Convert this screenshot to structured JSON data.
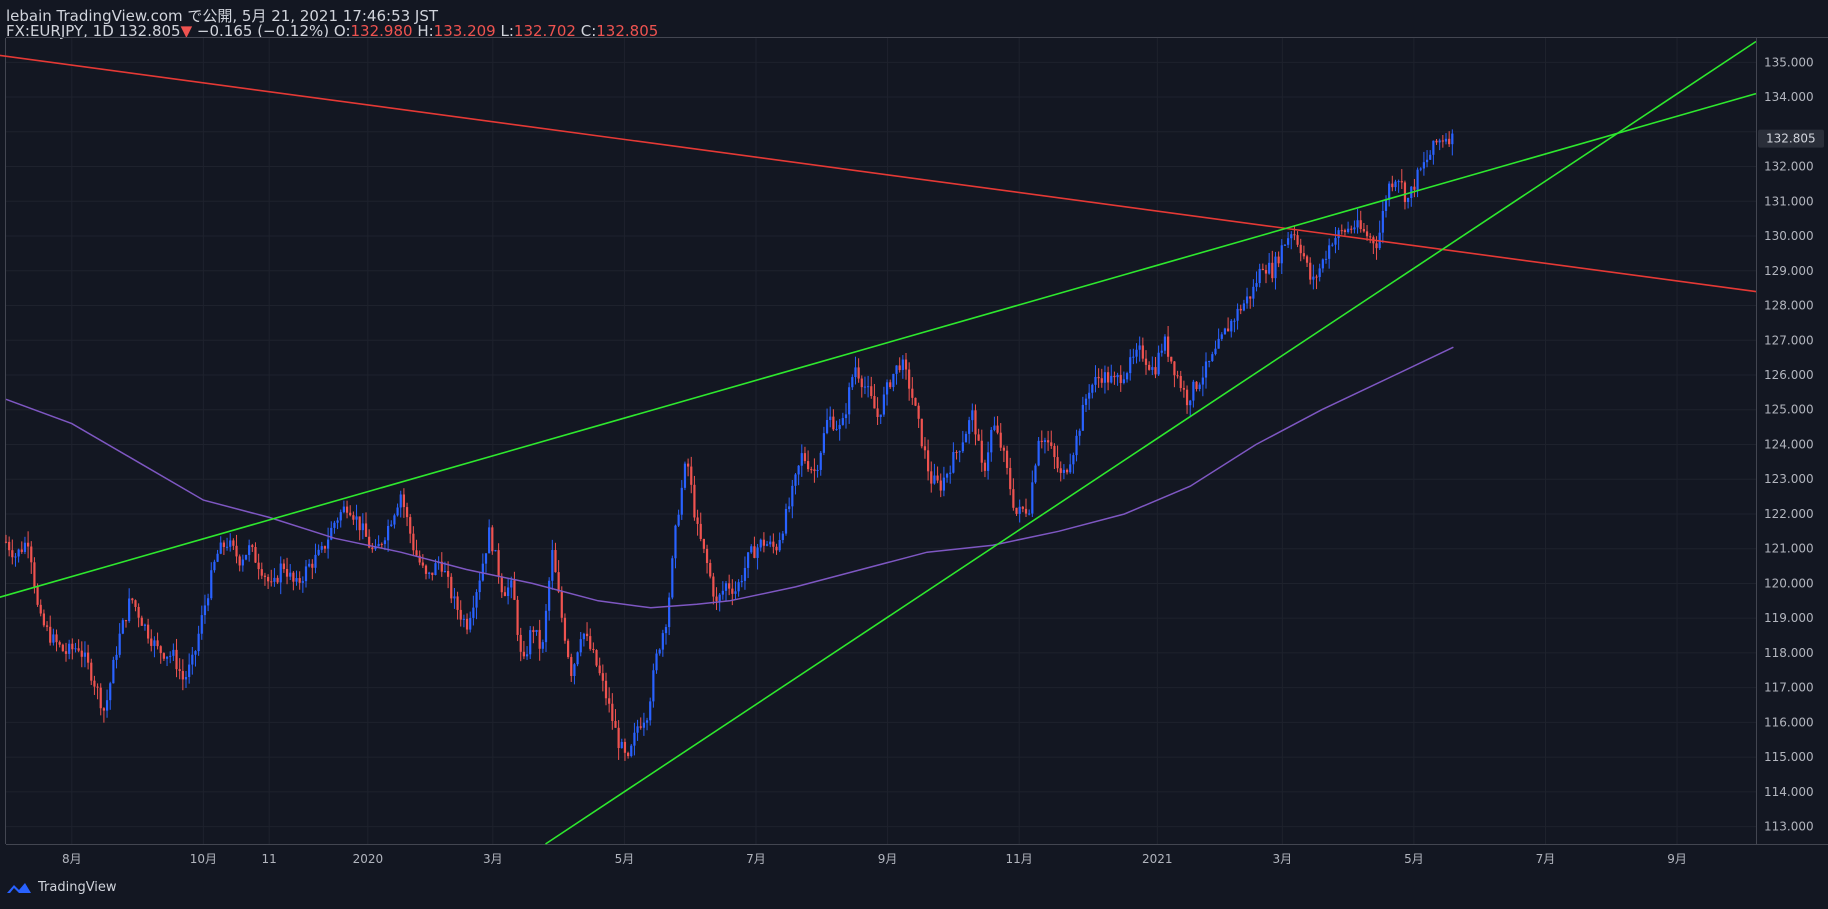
{
  "header": {
    "line1": "lebain TradingView.com で公開, 5月 21, 2021 17:46:53 JST",
    "symbol": "FX:EURJPY, 1D",
    "last": "132.805",
    "change": "−0.165 (−0.12%)",
    "o_label": "O:",
    "o_value": "132.980",
    "h_label": "H:",
    "h_value": "133.209",
    "l_label": "L:",
    "l_value": "132.702",
    "c_label": "C:",
    "c_value": "132.805"
  },
  "footer": {
    "brand": "TradingView",
    "icon": "tradingview-logo-icon"
  },
  "chart_data": {
    "type": "candlestick",
    "symbol": "EURJPY",
    "interval": "1D",
    "ylim": [
      112.5,
      135.7
    ],
    "y_ticks": [
      113,
      114,
      115,
      116,
      117,
      118,
      119,
      120,
      121,
      122,
      123,
      124,
      125,
      126,
      127,
      128,
      129,
      130,
      131,
      132,
      133,
      134,
      135
    ],
    "y_tick_labels": [
      "113.000",
      "114.000",
      "115.000",
      "116.000",
      "117.000",
      "118.000",
      "119.000",
      "120.000",
      "121.000",
      "122.000",
      "123.000",
      "124.000",
      "125.000",
      "126.000",
      "127.000",
      "128.000",
      "129.000",
      "130.000",
      "131.000",
      "132.000",
      "133.000",
      "134.000",
      "135.000"
    ],
    "last_price_label": "132.805",
    "x_range_months": [
      0,
      89.2
    ],
    "x_ticks": [
      {
        "month": 1.0,
        "label": "8月"
      },
      {
        "month": 3.0,
        "label": "10月"
      },
      {
        "month": 4.0,
        "label": "11"
      },
      {
        "month": 5.5,
        "label": "2020"
      },
      {
        "month": 7.4,
        "label": "3月"
      },
      {
        "month": 9.4,
        "label": "5月"
      },
      {
        "month": 11.4,
        "label": "7月"
      },
      {
        "month": 13.4,
        "label": "9月"
      },
      {
        "month": 15.4,
        "label": "11月"
      },
      {
        "month": 17.5,
        "label": "2021"
      },
      {
        "month": 19.4,
        "label": "3月"
      },
      {
        "month": 21.4,
        "label": "5月"
      },
      {
        "month": 23.4,
        "label": "7月"
      },
      {
        "month": 25.4,
        "label": "9月"
      }
    ],
    "month_index_note": "month index 0 = July 2019 start",
    "price_path": [
      [
        0.0,
        121.2
      ],
      [
        0.15,
        120.8
      ],
      [
        0.35,
        121.3
      ],
      [
        0.5,
        119.0
      ],
      [
        0.7,
        118.4
      ],
      [
        0.9,
        118.0
      ],
      [
        1.1,
        118.2
      ],
      [
        1.3,
        117.4
      ],
      [
        1.5,
        116.3
      ],
      [
        1.7,
        118.3
      ],
      [
        1.9,
        119.6
      ],
      [
        2.1,
        118.8
      ],
      [
        2.3,
        118.1
      ],
      [
        2.55,
        117.9
      ],
      [
        2.7,
        117.2
      ],
      [
        2.85,
        117.8
      ],
      [
        3.0,
        119.2
      ],
      [
        3.2,
        120.8
      ],
      [
        3.35,
        121.2
      ],
      [
        3.55,
        120.7
      ],
      [
        3.7,
        121.0
      ],
      [
        3.9,
        120.4
      ],
      [
        4.05,
        119.8
      ],
      [
        4.2,
        120.6
      ],
      [
        4.4,
        119.9
      ],
      [
        4.6,
        120.5
      ],
      [
        4.8,
        120.9
      ],
      [
        5.0,
        121.8
      ],
      [
        5.2,
        122.3
      ],
      [
        5.4,
        121.6
      ],
      [
        5.6,
        120.8
      ],
      [
        5.8,
        121.6
      ],
      [
        6.0,
        122.6
      ],
      [
        6.2,
        121.0
      ],
      [
        6.4,
        120.1
      ],
      [
        6.6,
        120.7
      ],
      [
        6.8,
        119.5
      ],
      [
        7.0,
        118.8
      ],
      [
        7.2,
        120.2
      ],
      [
        7.35,
        121.5
      ],
      [
        7.55,
        119.8
      ],
      [
        7.7,
        119.9
      ],
      [
        7.85,
        117.5
      ],
      [
        8.0,
        118.8
      ],
      [
        8.15,
        118.0
      ],
      [
        8.3,
        120.9
      ],
      [
        8.45,
        119.0
      ],
      [
        8.6,
        117.4
      ],
      [
        8.75,
        118.7
      ],
      [
        8.95,
        117.8
      ],
      [
        9.1,
        116.9
      ],
      [
        9.3,
        115.5
      ],
      [
        9.45,
        114.8
      ],
      [
        9.6,
        115.9
      ],
      [
        9.75,
        116.3
      ],
      [
        9.9,
        118.0
      ],
      [
        10.05,
        119.1
      ],
      [
        10.2,
        121.9
      ],
      [
        10.35,
        123.6
      ],
      [
        10.5,
        121.6
      ],
      [
        10.65,
        120.6
      ],
      [
        10.8,
        119.4
      ],
      [
        10.95,
        120.0
      ],
      [
        11.1,
        119.8
      ],
      [
        11.3,
        120.8
      ],
      [
        11.5,
        121.2
      ],
      [
        11.7,
        121.0
      ],
      [
        11.9,
        122.2
      ],
      [
        12.1,
        123.7
      ],
      [
        12.3,
        123.2
      ],
      [
        12.5,
        124.8
      ],
      [
        12.7,
        124.4
      ],
      [
        12.9,
        126.3
      ],
      [
        13.1,
        125.5
      ],
      [
        13.25,
        124.8
      ],
      [
        13.45,
        125.9
      ],
      [
        13.6,
        126.4
      ],
      [
        13.75,
        125.6
      ],
      [
        13.9,
        124.3
      ],
      [
        14.05,
        123.0
      ],
      [
        14.2,
        122.8
      ],
      [
        14.4,
        123.6
      ],
      [
        14.55,
        124.2
      ],
      [
        14.7,
        124.9
      ],
      [
        14.85,
        123.1
      ],
      [
        15.0,
        124.6
      ],
      [
        15.15,
        123.8
      ],
      [
        15.35,
        122.0
      ],
      [
        15.55,
        122.2
      ],
      [
        15.7,
        124.3
      ],
      [
        15.85,
        124.0
      ],
      [
        16.05,
        123.0
      ],
      [
        16.25,
        124.0
      ],
      [
        16.45,
        125.6
      ],
      [
        16.65,
        126.0
      ],
      [
        16.85,
        125.8
      ],
      [
        17.05,
        126.2
      ],
      [
        17.25,
        126.7
      ],
      [
        17.45,
        126.1
      ],
      [
        17.6,
        127.0
      ],
      [
        17.8,
        126.0
      ],
      [
        17.95,
        125.3
      ],
      [
        18.15,
        125.9
      ],
      [
        18.35,
        126.5
      ],
      [
        18.55,
        127.3
      ],
      [
        18.75,
        127.9
      ],
      [
        18.95,
        128.4
      ],
      [
        19.1,
        129.2
      ],
      [
        19.25,
        129.0
      ],
      [
        19.4,
        129.7
      ],
      [
        19.55,
        130.2
      ],
      [
        19.7,
        129.6
      ],
      [
        19.85,
        128.6
      ],
      [
        20.0,
        129.2
      ],
      [
        20.15,
        129.9
      ],
      [
        20.3,
        130.1
      ],
      [
        20.5,
        130.3
      ],
      [
        20.7,
        130.0
      ],
      [
        20.85,
        129.8
      ],
      [
        21.0,
        131.4
      ],
      [
        21.15,
        131.8
      ],
      [
        21.3,
        131.0
      ],
      [
        21.45,
        131.7
      ],
      [
        21.6,
        132.2
      ],
      [
        21.75,
        132.7
      ],
      [
        21.9,
        132.9
      ],
      [
        22.0,
        132.805
      ]
    ],
    "series": [
      {
        "name": "",
        "type": "moving_average",
        "color": "#7e57c2",
        "points": [
          [
            0.0,
            125.3
          ],
          [
            1.0,
            124.6
          ],
          [
            2.0,
            123.5
          ],
          [
            3.0,
            122.4
          ],
          [
            4.0,
            121.9
          ],
          [
            5.0,
            121.3
          ],
          [
            6.0,
            120.9
          ],
          [
            7.0,
            120.4
          ],
          [
            8.0,
            120.0
          ],
          [
            9.0,
            119.5
          ],
          [
            9.8,
            119.3
          ],
          [
            10.5,
            119.4
          ],
          [
            11.0,
            119.5
          ],
          [
            12.0,
            119.9
          ],
          [
            13.0,
            120.4
          ],
          [
            14.0,
            120.9
          ],
          [
            15.0,
            121.1
          ],
          [
            16.0,
            121.5
          ],
          [
            17.0,
            122.0
          ],
          [
            18.0,
            122.8
          ],
          [
            19.0,
            124.0
          ],
          [
            20.0,
            125.0
          ],
          [
            21.0,
            125.9
          ],
          [
            22.0,
            126.8
          ]
        ]
      },
      {
        "name": "",
        "type": "trendline",
        "color": "#e53935",
        "points": [
          [
            -0.1,
            135.2
          ],
          [
            26.6,
            128.4
          ]
        ]
      },
      {
        "name": "",
        "type": "trendline",
        "color": "#2ee82e",
        "points": [
          [
            -0.1,
            119.6
          ],
          [
            26.6,
            134.1
          ]
        ]
      },
      {
        "name": "",
        "type": "trendline",
        "color": "#2ee82e",
        "points": [
          [
            8.2,
            112.5
          ],
          [
            26.6,
            135.6
          ]
        ]
      }
    ],
    "colors": {
      "up": "#2962ff",
      "down": "#ef5350",
      "grid": "#1e222d",
      "axis_text": "#b2b5be"
    },
    "grid": true,
    "legend": "none"
  }
}
